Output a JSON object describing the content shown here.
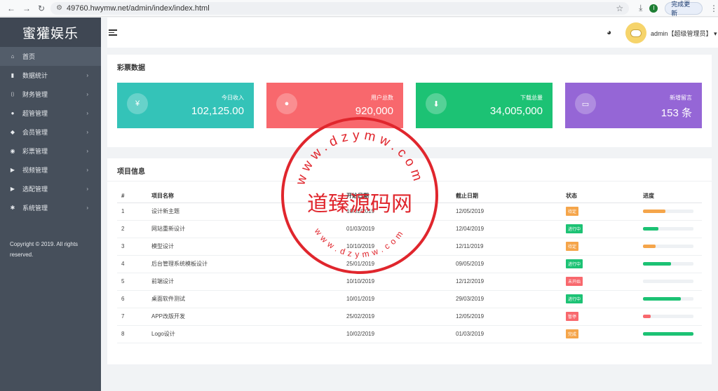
{
  "browser": {
    "url": "49760.hwymw.net/admin/index/index.html",
    "profile_letter": "I",
    "update_button": "完成更新"
  },
  "sidebar": {
    "brand": "蜜獾娱乐",
    "items": [
      {
        "label": "首页",
        "icon": "home-icon",
        "glyph": "⌂",
        "active": true,
        "has_arrow": false
      },
      {
        "label": "数据统计",
        "icon": "bar-chart-icon",
        "glyph": "▮",
        "active": false,
        "has_arrow": true
      },
      {
        "label": "财务管理",
        "icon": "bank-icon",
        "glyph": "⌷",
        "active": false,
        "has_arrow": true
      },
      {
        "label": "超管管理",
        "icon": "user-icon",
        "glyph": "●",
        "active": false,
        "has_arrow": true
      },
      {
        "label": "会员管理",
        "icon": "users-icon",
        "glyph": "◆",
        "active": false,
        "has_arrow": true
      },
      {
        "label": "彩票管理",
        "icon": "gamepad-icon",
        "glyph": "◉",
        "active": false,
        "has_arrow": true
      },
      {
        "label": "视频管理",
        "icon": "video-icon",
        "glyph": "▶",
        "active": false,
        "has_arrow": true
      },
      {
        "label": "选配管理",
        "icon": "video-camera-icon",
        "glyph": "▶",
        "active": false,
        "has_arrow": true
      },
      {
        "label": "系统管理",
        "icon": "gear-icon",
        "glyph": "✱",
        "active": false,
        "has_arrow": true
      }
    ],
    "copyright": "Copyright © 2019. All rights reserved."
  },
  "header": {
    "user": "admin【超级管理员】",
    "palette_icon": "palette-icon"
  },
  "lottery": {
    "title": "彩票数据",
    "cards": [
      {
        "label": "今日收入",
        "value": "102,125.00",
        "icon": "yen-icon",
        "glyph": "¥",
        "color": "#34c3b8"
      },
      {
        "label": "用户总数",
        "value": "920,000",
        "icon": "user-icon",
        "glyph": "●",
        "color": "#f8686d"
      },
      {
        "label": "下载总量",
        "value": "34,005,000",
        "icon": "download-icon",
        "glyph": "⬇",
        "color": "#1cc274"
      },
      {
        "label": "新增留言",
        "value": "153 条",
        "icon": "message-icon",
        "glyph": "▭",
        "color": "#9566d6"
      }
    ]
  },
  "projects": {
    "title": "项目信息",
    "headers": [
      "#",
      "项目名称",
      "开始日期",
      "截止日期",
      "状态",
      "进度"
    ],
    "rows": [
      {
        "num": "1",
        "name": "设计新主题",
        "start": "10/02/2019",
        "end": "12/05/2019",
        "status": "待定",
        "status_color": "#f5a54a",
        "progress": 0.45,
        "bar_color": "#f5a54a"
      },
      {
        "num": "2",
        "name": "网站重新设计",
        "start": "01/03/2019",
        "end": "12/04/2019",
        "status": "进行中",
        "status_color": "#1cc274",
        "progress": 0.3,
        "bar_color": "#1cc274"
      },
      {
        "num": "3",
        "name": "模型设计",
        "start": "10/10/2019",
        "end": "12/11/2019",
        "status": "待定",
        "status_color": "#f5a54a",
        "progress": 0.25,
        "bar_color": "#f5a54a"
      },
      {
        "num": "4",
        "name": "后台管理系统模板设计",
        "start": "25/01/2019",
        "end": "09/05/2019",
        "status": "进行中",
        "status_color": "#1cc274",
        "progress": 0.55,
        "bar_color": "#1cc274"
      },
      {
        "num": "5",
        "name": "前端设计",
        "start": "10/10/2019",
        "end": "12/12/2019",
        "status": "未开始",
        "status_color": "#f8686d",
        "progress": 0,
        "bar_color": "#f8686d"
      },
      {
        "num": "6",
        "name": "桌面软件测试",
        "start": "10/01/2019",
        "end": "29/03/2019",
        "status": "进行中",
        "status_color": "#1cc274",
        "progress": 0.75,
        "bar_color": "#1cc274"
      },
      {
        "num": "7",
        "name": "APP改版开发",
        "start": "25/02/2019",
        "end": "12/05/2019",
        "status": "暂停",
        "status_color": "#f8686d",
        "progress": 0.15,
        "bar_color": "#f8686d"
      },
      {
        "num": "8",
        "name": "Logo设计",
        "start": "10/02/2019",
        "end": "01/03/2019",
        "status": "完成",
        "status_color": "#f5a54a",
        "progress": 1.0,
        "bar_color": "#1cc274"
      }
    ]
  },
  "watermark": {
    "center_text": "道臻源码网",
    "top_arc": "www.dzymw.com",
    "bottom_arc": "www.dzymw.com",
    "color": "#e0262d"
  }
}
